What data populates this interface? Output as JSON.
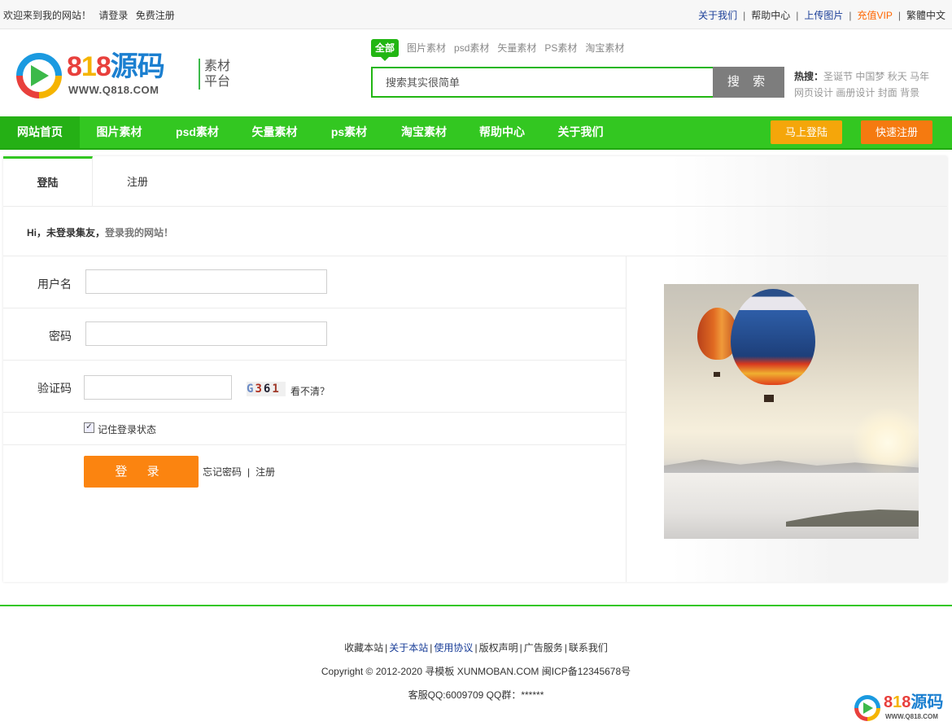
{
  "topbar": {
    "welcome": "欢迎来到我的网站！",
    "login": "请登录",
    "register": "免费注册",
    "links": [
      "关于我们",
      "帮助中心",
      "上传图片",
      "充值VIP",
      "繁體中文"
    ],
    "separator": "|"
  },
  "header": {
    "logo_brand": [
      "8",
      "1",
      "8",
      "源码"
    ],
    "logo_url": "WWW.Q818.COM",
    "slogan_line1": "素材",
    "slogan_line2": "平台",
    "search_tabs": [
      "全部",
      "图片素材",
      "psd素材",
      "矢量素材",
      "PS素材",
      "淘宝素材"
    ],
    "search_placeholder": "搜索其实很简单",
    "search_button": "搜 索",
    "hot_label": "热搜：",
    "hot_words": [
      "圣诞节",
      "中国梦",
      "秋天",
      "马年",
      "网页设计",
      "画册设计",
      "封面",
      "背景"
    ]
  },
  "nav": {
    "items": [
      "网站首页",
      "图片素材",
      "psd素材",
      "矢量素材",
      "ps素材",
      "淘宝素材",
      "帮助中心",
      "关于我们"
    ],
    "login_button": "马上登陆",
    "register_button": "快速注册"
  },
  "panel": {
    "tab_login": "登陆",
    "tab_register": "注册",
    "hi_prefix": "Hi，未登录集友，",
    "hi_link": "登录我的网站！",
    "username_label": "用户名",
    "password_label": "密码",
    "captcha_label": "验证码",
    "captcha_chars": [
      "G",
      "3",
      "6",
      "1"
    ],
    "unclear_link": "看不清？",
    "checkbox_mark": "✓",
    "remember_label": "记住登录状态",
    "submit_button": "登 录",
    "forgot_link": "忘记密码",
    "link_separator": "|",
    "register_link": "注册"
  },
  "footer": {
    "links": [
      "收藏本站",
      "关于本站",
      "使用协议",
      "版权声明",
      "广告服务",
      "联系我们"
    ],
    "separator": "|",
    "copyright": "Copyright © 2012-2020 寻模板 XUNMOBAN.COM 闽ICP备12345678号",
    "contact": "客服QQ:6009709 QQ群：******"
  },
  "watermark": {
    "brand": [
      "8",
      "1",
      "8",
      "源码"
    ],
    "url": "WWW.Q818.COM"
  },
  "colors": {
    "brand_green": "#33c721",
    "accent_orange": "#fb8410",
    "link_blue": "#1a3e98",
    "vip_orange": "#ff6600"
  }
}
